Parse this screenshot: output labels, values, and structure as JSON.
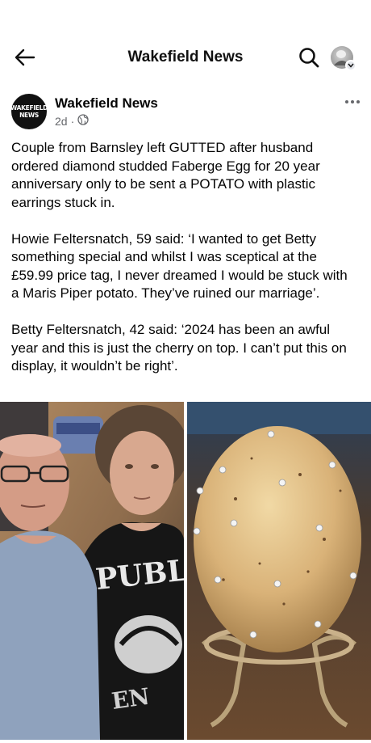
{
  "header": {
    "title": "Wakefield News",
    "icons": [
      "back-arrow-icon",
      "search-icon",
      "profile-avatar"
    ]
  },
  "post": {
    "page_name": "Wakefield News",
    "logo_text_line1": "WAKEFIELD",
    "logo_text_line2": "NEWS",
    "time": "2d",
    "separator": "·",
    "privacy_icon": "globe-icon",
    "paragraphs": [
      "Couple from Barnsley left GUTTED after husband ordered diamond studded Faberge Egg for 20 year anniversary only to be sent a POTATO with plastic earrings stuck in.",
      "Howie Feltersnatch, 59 said: ‘I wanted to get Betty something special and whilst I was sceptical at the £59.99 price tag, I never dreamed I would be stuck with a Maris Piper potato. They’ve ruined our marriage’.",
      "Betty Feltersnatch, 42 said: ‘2024 has been an awful year and this is just the cherry on top. I can’t put this on display, it wouldn’t be right’."
    ],
    "photo_left_shirt_text": "PUBL",
    "photo_left_shirt_text2": "EN"
  },
  "colors": {
    "text": "#050505",
    "meta": "#65676b",
    "background": "#ffffff"
  }
}
